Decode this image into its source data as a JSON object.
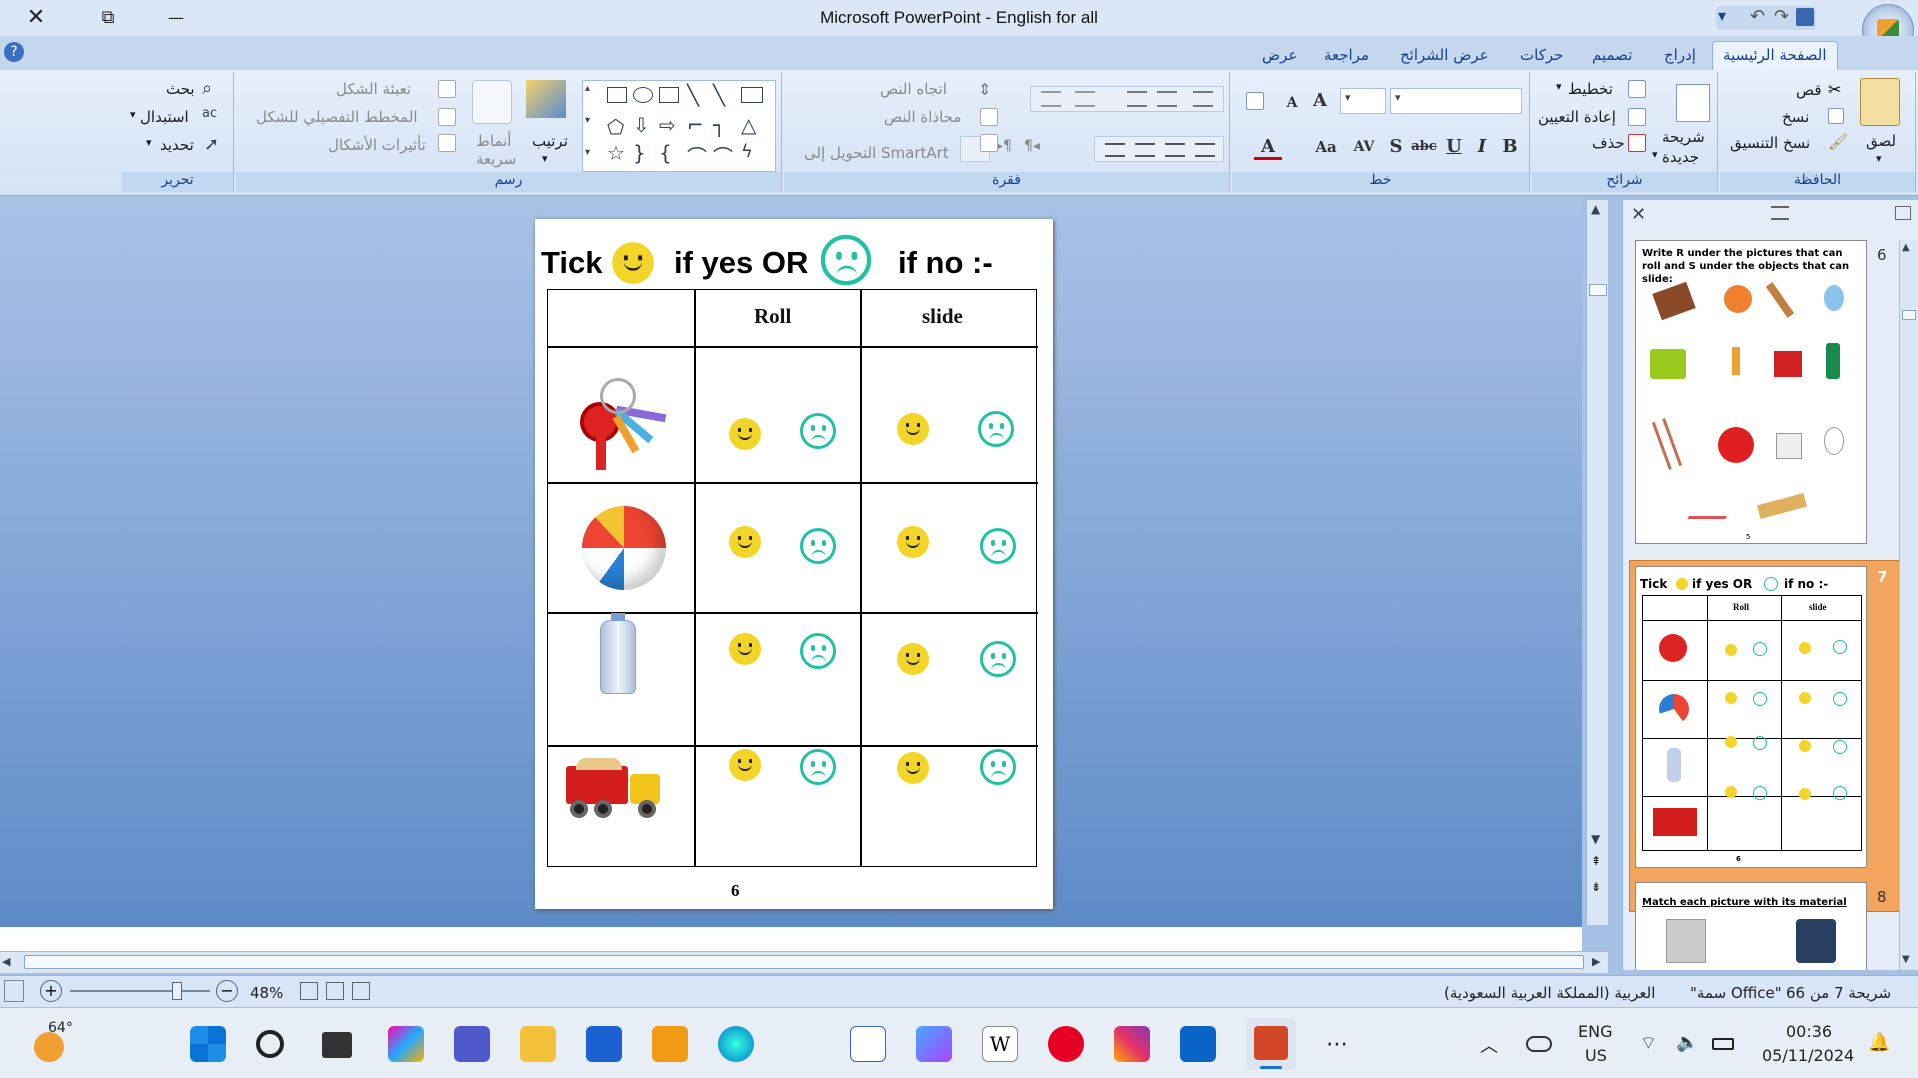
{
  "window": {
    "title": "Microsoft PowerPoint - English for all",
    "close": "✕",
    "restore": "⧉",
    "minimize": "—"
  },
  "tabs": [
    "الصفحة الرئيسية",
    "إدراج",
    "تصميم",
    "حركات",
    "عرض الشرائح",
    "مراجعة",
    "عرض"
  ],
  "ribbon": {
    "clipboard": {
      "label": "الحافظة",
      "paste": "لصق",
      "cut": "قص",
      "copy": "نسخ",
      "format_painter": "نسخ التنسيق"
    },
    "slides": {
      "label": "شرائح",
      "new_slide_1": "شريحة",
      "new_slide_2": "جديدة",
      "layout": "تخطيط",
      "reset": "إعادة التعيين",
      "delete": "حذف"
    },
    "font": {
      "label": "خط",
      "bold": "B",
      "italic": "I",
      "underline": "U",
      "strike": "abc",
      "shadow": "S",
      "spacing": "AV",
      "case": "Aa",
      "grow": "A",
      "shrink": "A",
      "color": "A"
    },
    "paragraph": {
      "label": "فقرة",
      "text_direction": "اتجاه النص",
      "align_text": "محاذاة النص",
      "smartart": "التحويل إلى SmartArt"
    },
    "drawing": {
      "label": "رسم",
      "arrange": "ترتيب",
      "quick_styles_1": "أنماط",
      "quick_styles_2": "سريعة",
      "shape_fill": "تعبئة الشكل",
      "shape_outline": "المخطط التفصيلي للشكل",
      "shape_effects": "تأثيرات الأشكال"
    },
    "editing": {
      "label": "تحرير",
      "find": "بحث",
      "replace": "استبدال",
      "select": "تحديد"
    }
  },
  "slide": {
    "tick_word": "Tick",
    "if_yes_or": "if yes OR",
    "if_no": "if no :-",
    "col_roll": "Roll",
    "col_slide": "slide",
    "rows": [
      "keys",
      "beach ball",
      "water bottle",
      "dump truck"
    ],
    "page_number": "6"
  },
  "thumbnails": [
    {
      "number": "6",
      "title": "Write R under the pictures that can roll and S under the objects that can slide:",
      "page": "5"
    },
    {
      "number": "7",
      "tick": "Tick",
      "yes": "if yes OR",
      "no": "if no :-",
      "roll": "Roll",
      "slide": "slide",
      "page": "6"
    },
    {
      "number": "8",
      "title": "Match each picture with its material"
    }
  ],
  "status": {
    "slide_of": "شريحة 7 من 66",
    "theme": "\"سمة Office\"",
    "language": "العربية (المملكة العربية السعودية)",
    "zoom": "48%"
  },
  "taskbar": {
    "weather": "64°",
    "lang1": "ENG",
    "lang2": "US",
    "time": "00:36",
    "date": "05/11/2024"
  },
  "colors": {
    "accent": "#15428b",
    "smile": "#f3d52a",
    "sad": "#22c1a4",
    "ribbon": "#dbe7f6"
  }
}
